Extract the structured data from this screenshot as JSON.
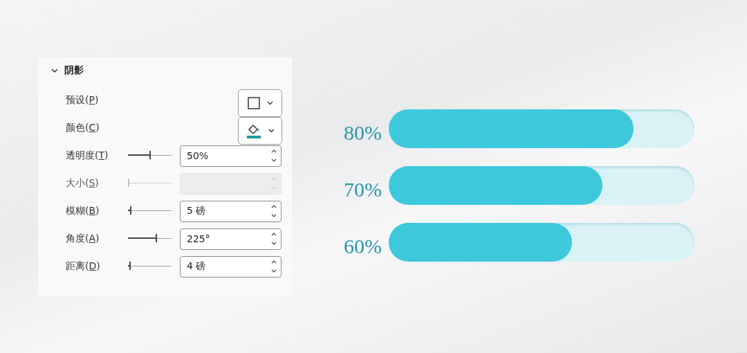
{
  "panel": {
    "section": {
      "title": "阴影",
      "expanded": true
    },
    "rows": [
      {
        "kind": "preset-dropdown",
        "label": "预设(P)"
      },
      {
        "kind": "color-dropdown",
        "label": "颜色(C)",
        "color": "#1a9ba3"
      },
      {
        "kind": "spinner",
        "label": "透明度(T)",
        "level": 0.5,
        "value": "50%",
        "disabled": false
      },
      {
        "kind": "spinner",
        "label": "大小(S)",
        "level": 0,
        "disabled": true
      },
      {
        "kind": "spinner",
        "label": "模糊(B)",
        "level": 0.05,
        "value": "5 磅",
        "disabled": false
      },
      {
        "kind": "spinner",
        "label": "角度(A)",
        "level": 0.66,
        "value": "225°",
        "disabled": false
      },
      {
        "kind": "spinner",
        "label": "距离(D)",
        "level": 0.03,
        "value": "4 磅",
        "disabled": false
      }
    ]
  },
  "progress": [
    {
      "label": "80%",
      "level": 0.8
    },
    {
      "label": "70%",
      "level": 0.7
    },
    {
      "label": "60%",
      "level": 0.6
    }
  ]
}
